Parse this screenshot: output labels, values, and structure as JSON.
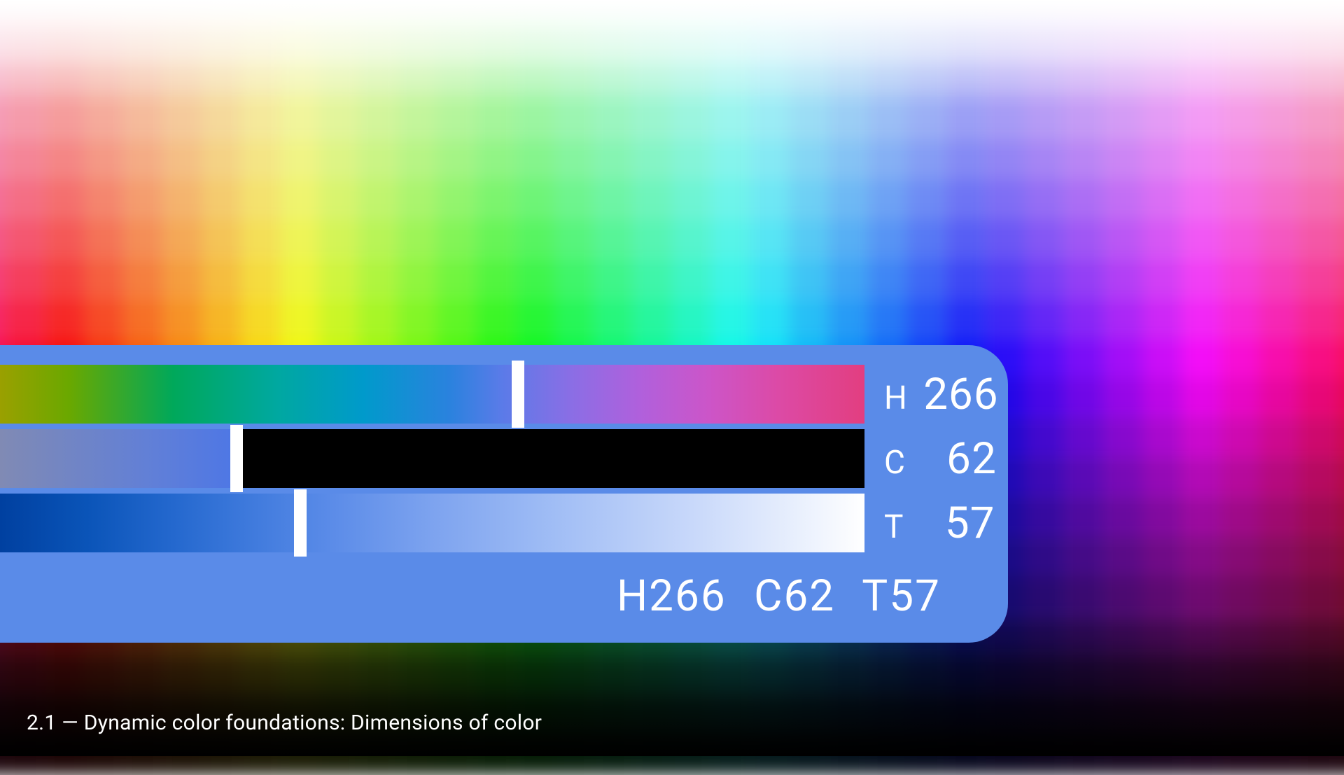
{
  "panel": {
    "bg": "#5A8BE8",
    "sliders": {
      "hue": {
        "key": "H",
        "value": 266,
        "min": 0,
        "max": 360,
        "thumb_pct": 59.9
      },
      "chroma": {
        "key": "C",
        "value": 62,
        "min": 0,
        "max": 150,
        "thumb_pct": 27.4
      },
      "tone": {
        "key": "T",
        "value": 57,
        "min": 0,
        "max": 100,
        "thumb_pct": 34.7
      }
    },
    "summary": "H266  C62  T57"
  },
  "caption": "2.1 — Dynamic color foundations: Dimensions of color",
  "background": {
    "cols": 36,
    "rows": 20
  }
}
